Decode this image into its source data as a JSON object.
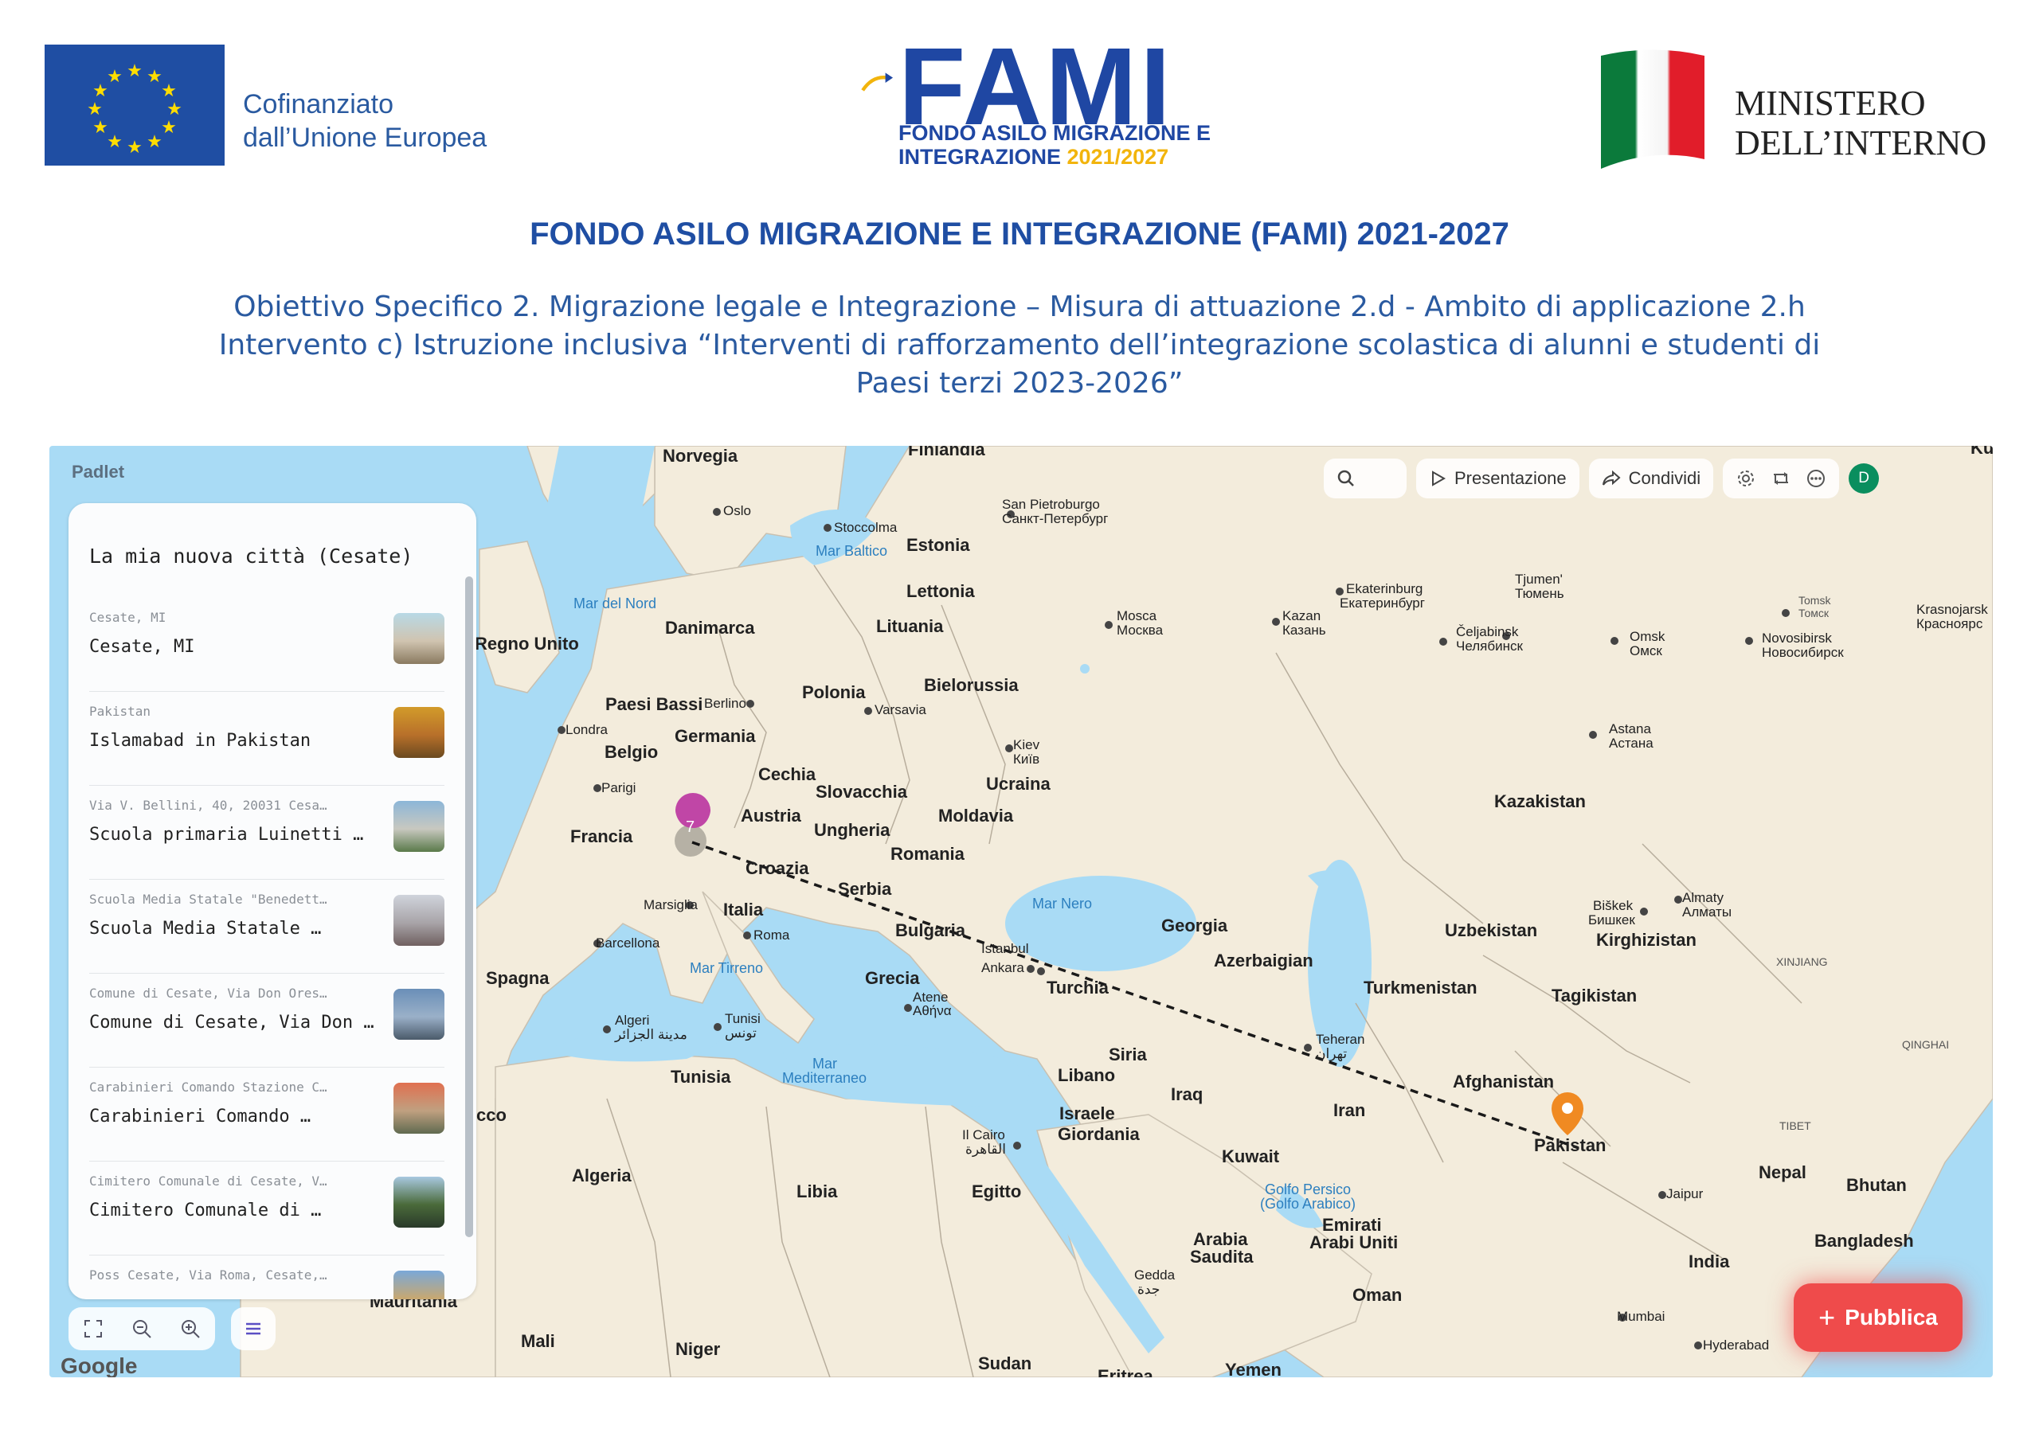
{
  "header": {
    "eu_text_line1": "Cofinanziato",
    "eu_text_line2": "dall’Unione Europea",
    "fami_word": "FAMI",
    "fami_sub1": "FONDO ASILO MIGRAZIONE E",
    "fami_sub2_a": "INTEGRAZIONE ",
    "fami_sub2_year": "2021/2027",
    "ministry_line1": "MINISTERO",
    "ministry_line2": "DELL’INTERNO"
  },
  "title": "FONDO ASILO MIGRAZIONE E INTEGRAZIONE (FAMI) 2021-2027",
  "subtitle_line1": "Obiettivo Specifico 2. Migrazione legale e Integrazione – Misura di attuazione 2.d - Ambito di applicazione 2.h",
  "subtitle_line2": "Intervento c) Istruzione inclusiva “Interventi di rafforzamento dell’integrazione scolastica di alunni e studenti di",
  "subtitle_line3": "Paesi terzi 2023-2026”",
  "padlet": {
    "logo": "Padlet",
    "toolbar": {
      "presentation": "Presentazione",
      "share": "Condividi",
      "avatar_letter": "D"
    },
    "panel_title": "La mia nuova città (Cesate)",
    "items": [
      {
        "address": "Cesate, MI",
        "name": "Cesate, MI"
      },
      {
        "address": "Pakistan",
        "name": "Islamabad in Pakistan"
      },
      {
        "address": "Via V. Bellini, 40, 20031 Cesa…",
        "name": "Scuola primaria Luinetti …"
      },
      {
        "address": "Scuola Media Statale \"Benedett…",
        "name": "Scuola Media Statale …"
      },
      {
        "address": "Comune di Cesate, Via Don Ores…",
        "name": "Comune di Cesate, Via Don …"
      },
      {
        "address": "Carabinieri Comando Stazione C…",
        "name": "Carabinieri Comando …"
      },
      {
        "address": "Cimitero Comunale di Cesate, V…",
        "name": "Cimitero Comunale di …"
      },
      {
        "address": "Poss Cesate, Via Roma, Cesate,…",
        "name": ""
      }
    ],
    "cluster_count": "7",
    "google": "Google",
    "publish": "Pubblica"
  },
  "map_labels": {
    "norvegia": "Norvegia",
    "finlandia": "Finlandia",
    "oslo": "Oslo",
    "stoccolma": "Stoccolma",
    "san_pietroburgo": "San Pietroburgo",
    "san_pietroburgo_ru": "Санкт-Петербург",
    "estonia": "Estonia",
    "mar_baltico": "Mar Baltico",
    "lettonia": "Lettonia",
    "mar_del_nord": "Mar del Nord",
    "danimarca": "Danimarca",
    "lituania": "Lituania",
    "regno_unito": "Regno Unito",
    "bielorussia": "Bielorussia",
    "polonia": "Polonia",
    "varsavia": "Varsavia",
    "paesi_bassi": "Paesi Bassi",
    "berlino": "Berlino",
    "londra": "Londra",
    "germania": "Germania",
    "belgio": "Belgio",
    "parigi": "Parigi",
    "cechia": "Cechia",
    "slovacchia": "Slovacchia",
    "ucraina": "Ucraina",
    "kiev": "Kiev",
    "kiev_ua": "Київ",
    "austria": "Austria",
    "ungheria": "Ungheria",
    "moldavia": "Moldavia",
    "francia": "Francia",
    "croazia": "Croazia",
    "romania": "Romania",
    "serbia": "Serbia",
    "marsiglia": "Marsiglia",
    "italia": "Italia",
    "roma": "Roma",
    "barcellona": "Barcellona",
    "bulgaria": "Bulgaria",
    "istanbul": "Istanbul",
    "ankara": "Ankara",
    "mar_nero": "Mar Nero",
    "georgia": "Georgia",
    "azerbaigian": "Azerbaigian",
    "mar_tirreno": "Mar Tirreno",
    "spagna": "Spagna",
    "grecia": "Grecia",
    "atene": "Atene",
    "atene_gr": "Αθήνα",
    "turchia": "Turchia",
    "algeri": "Algeri",
    "algeri_ar": "مدينة الجزائر",
    "tunisi": "Tunisi",
    "tunisi_ar": "تونس",
    "tunisia": "Tunisia",
    "mar_mediterraneo": "Mar",
    "mar_mediterraneo2": "Mediterraneo",
    "siria": "Siria",
    "libano": "Libano",
    "iraq": "Iraq",
    "israele": "Israele",
    "giordania": "Giordania",
    "il_cairo": "Il Cairo",
    "il_cairo_ar": "القاهرة",
    "iran": "Iran",
    "kuwait": "Kuwait",
    "teheran": "Teheran",
    "teheran_fa": "تهران",
    "algeria": "Algeria",
    "libia": "Libia",
    "egitto": "Egitto",
    "golfo": "Golfo Persico",
    "golfo2": "(Golfo Arabico)",
    "emirati": "Emirati",
    "emirati2": "Arabi Uniti",
    "arabia": "Arabia",
    "arabia2": "Saudita",
    "gedda": "Gedda",
    "gedda_ar": "جدة",
    "oman": "Oman",
    "mauritania": "Mauritania",
    "mali": "Mali",
    "niger": "Niger",
    "sudan": "Sudan",
    "eritrea": "Eritrea",
    "yemen": "Yemen",
    "mosca": "Mosca",
    "mosca_ru": "Москва",
    "kazan": "Kazan",
    "kazan_ru": "Казань",
    "ekaterinburg": "Ekaterinburg",
    "ekaterinburg_ru": "Екатеринбург",
    "tjumen": "Tjumen'",
    "tjumen_ru": "Тюмень",
    "celjabinsk": "Čeljabinsk",
    "celjabinsk_ru": "Челябинск",
    "omsk": "Omsk",
    "omsk_ru": "Омск",
    "tomsk": "Tomsk",
    "tomsk_ru": "Томск",
    "novosibirsk": "Novosibirsk",
    "novosibirsk_ru": "Новосибирск",
    "krasnojarsk": "Krasnojarsk",
    "krasnojarsk_ru": "Красноярс",
    "astana": "Astana",
    "astana_ru": "Астана",
    "kazakistan": "Kazakistan",
    "uzbekistan": "Uzbekistan",
    "biskek": "Biškek",
    "biskek_ru": "Бишкек",
    "almaty": "Almaty",
    "almaty_ru": "Алматы",
    "kirghizistan": "Kirghizistan",
    "xinjiang": "XINJIANG",
    "turkmenistan": "Turkmenistan",
    "tagikistan": "Tagikistan",
    "qinghai": "QINGHAI",
    "afghanistan": "Afghanistan",
    "pakistan": "Pakistan",
    "tibet": "TIBET",
    "nepal": "Nepal",
    "bhutan": "Bhutan",
    "bangladesh": "Bangladesh",
    "india": "India",
    "jaipur": "Jaipur",
    "mumbai": "Mumbai",
    "hyderabad": "Hyderabad",
    "cco": "cco",
    "ku": "Ku"
  }
}
